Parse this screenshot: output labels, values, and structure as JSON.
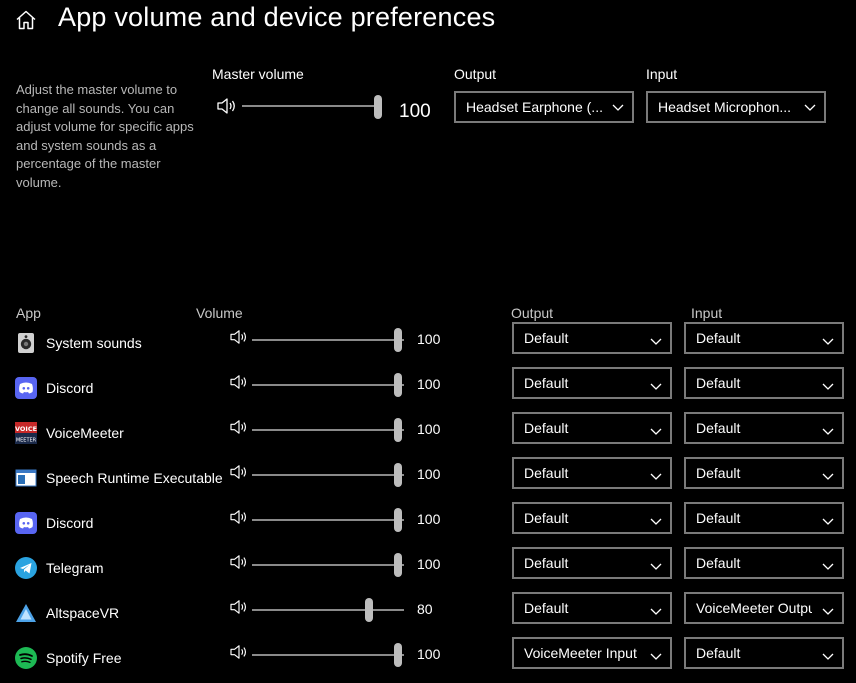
{
  "header": {
    "title": "App volume and device preferences",
    "home_icon": "home-icon"
  },
  "master": {
    "description": "Adjust the master volume to change all sounds. You can adjust volume for specific apps and system sounds as a percentage of the master volume.",
    "volume_label": "Master volume",
    "volume_value": "100",
    "volume_level": 1.0,
    "output_label": "Output",
    "output_value": "Headset Earphone (...",
    "input_label": "Input",
    "input_value": "Headset Microphon..."
  },
  "columns": {
    "app": "App",
    "volume": "Volume",
    "output": "Output",
    "input": "Input"
  },
  "apps": [
    {
      "name": "System sounds",
      "icon": "speaker-device-icon",
      "volume": "100",
      "level": 1.0,
      "output": "Default",
      "input": "Default"
    },
    {
      "name": "Discord",
      "icon": "discord-icon",
      "volume": "100",
      "level": 1.0,
      "output": "Default",
      "input": "Default"
    },
    {
      "name": "VoiceMeeter",
      "icon": "voicemeeter-icon",
      "volume": "100",
      "level": 1.0,
      "output": "Default",
      "input": "Default"
    },
    {
      "name": "Speech Runtime Executable",
      "icon": "window-app-icon",
      "volume": "100",
      "level": 1.0,
      "output": "Default",
      "input": "Default"
    },
    {
      "name": "Discord",
      "icon": "discord-icon",
      "volume": "100",
      "level": 1.0,
      "output": "Default",
      "input": "Default"
    },
    {
      "name": "Telegram",
      "icon": "telegram-icon",
      "volume": "100",
      "level": 1.0,
      "output": "Default",
      "input": "Default"
    },
    {
      "name": "AltspaceVR",
      "icon": "altspacevr-icon",
      "volume": "80",
      "level": 0.8,
      "output": "Default",
      "input": "VoiceMeeter Outpu"
    },
    {
      "name": "Spotify Free",
      "icon": "spotify-icon",
      "volume": "100",
      "level": 1.0,
      "output": "VoiceMeeter Input",
      "input": "Default"
    }
  ],
  "colors": {
    "background": "#000000",
    "track": "#8a8a8a",
    "thumb": "#bdbdbd",
    "border": "#7a7a7a",
    "discord": "#5865f2",
    "telegram": "#2aa3e0",
    "spotify": "#1db954"
  }
}
